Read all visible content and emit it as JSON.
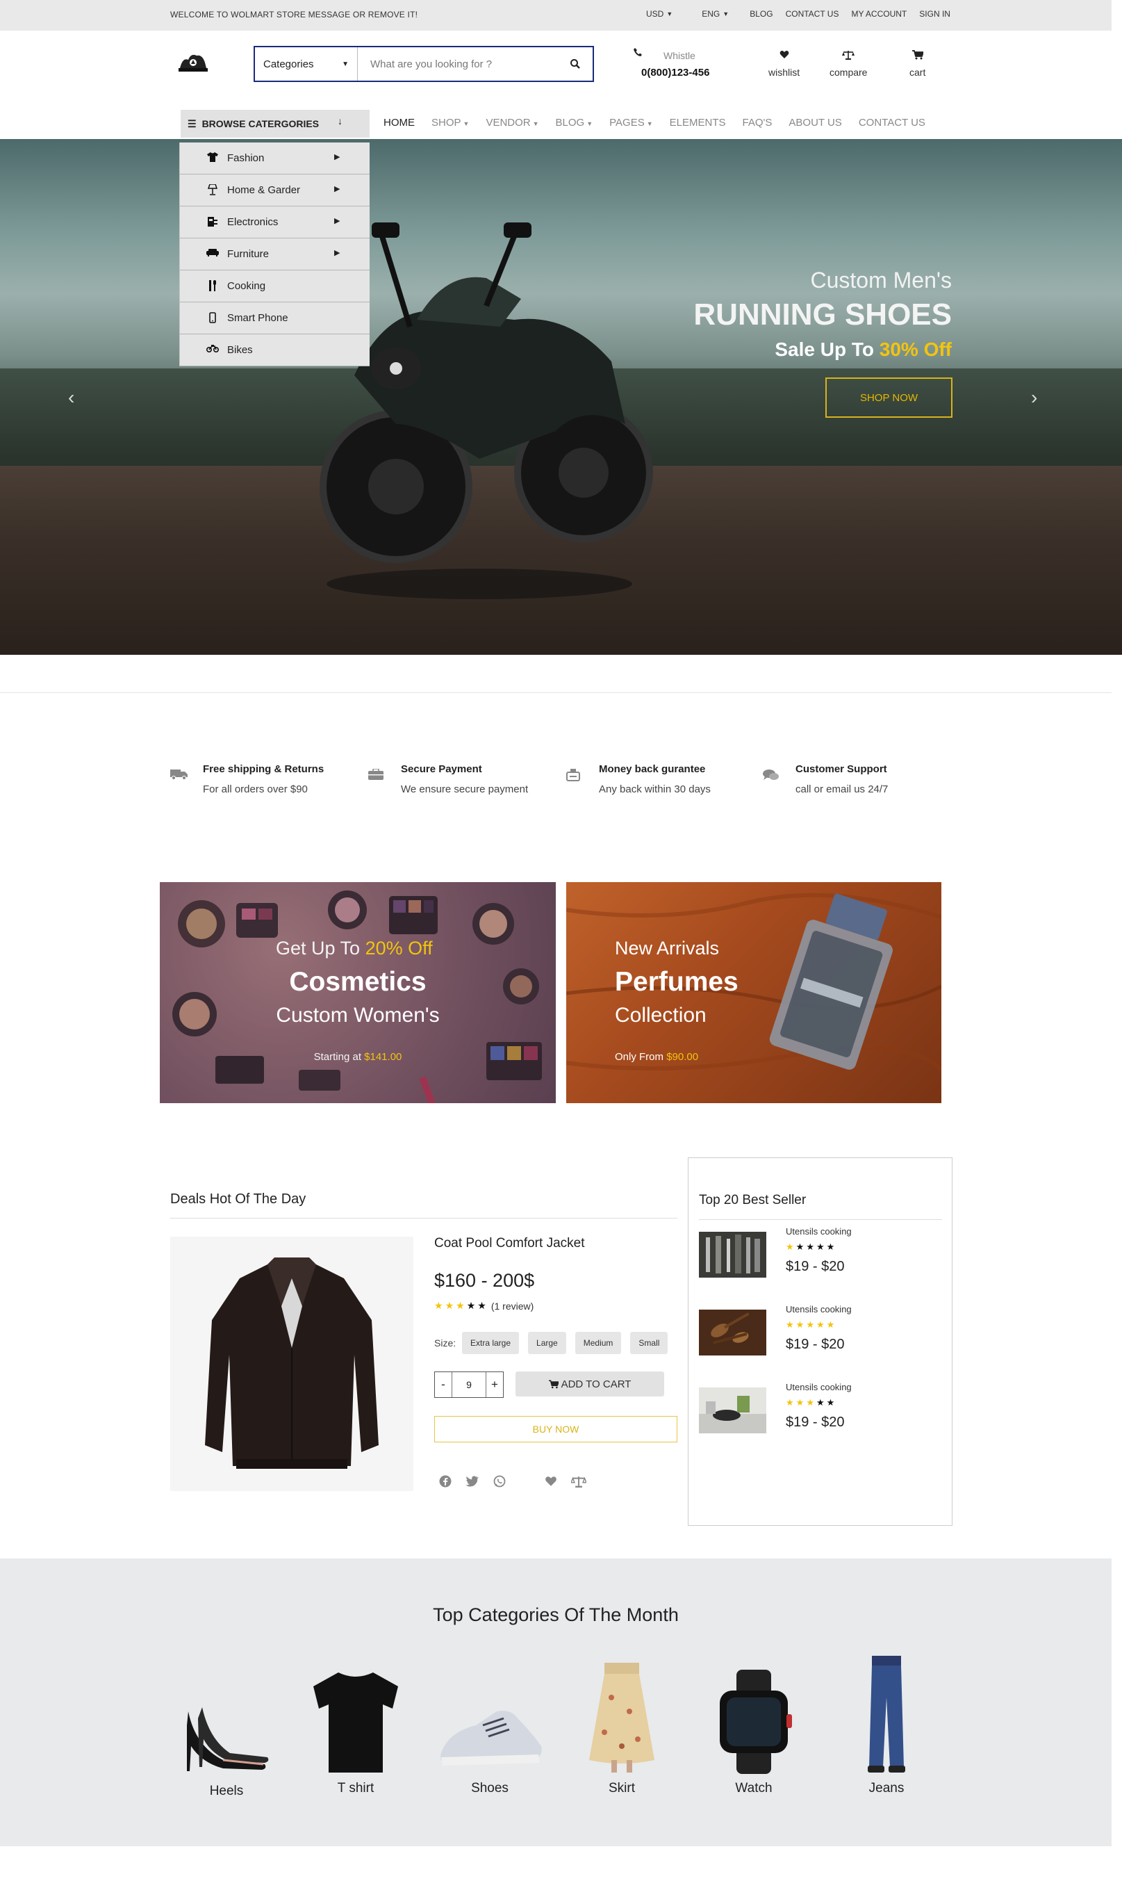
{
  "topbar": {
    "welcome": "WELCOME TO WOLMART STORE MESSAGE OR REMOVE IT!",
    "currency": "USD",
    "language": "ENG",
    "links": [
      "BLOG",
      "CONTACT US",
      "MY ACCOUNT",
      "SIGN IN"
    ]
  },
  "header": {
    "search": {
      "category": "Categories",
      "placeholder": "What are you looking for ?"
    },
    "contact": {
      "label": "Whistle",
      "phone": "0(800)123-456"
    },
    "icons": {
      "wishlist": "wishlist",
      "compare": "compare",
      "cart": "cart"
    }
  },
  "nav": {
    "browse": "BROWSE CATERGORIES",
    "items": [
      "HOME",
      "SHOP",
      "VENDOR",
      "BLOG",
      "PAGES",
      "ELEMENTS",
      "FAQ'S",
      "ABOUT US",
      "CONTACT US"
    ]
  },
  "categories": [
    {
      "label": "Fashion",
      "icon": "tshirt-icon"
    },
    {
      "label": "Home & Garder",
      "icon": "lamp-icon"
    },
    {
      "label": "Electronics",
      "icon": "plug-icon"
    },
    {
      "label": "Furniture",
      "icon": "sofa-icon"
    },
    {
      "label": "Cooking",
      "icon": "utensils-icon"
    },
    {
      "label": "Smart Phone",
      "icon": "phone-icon"
    },
    {
      "label": "Bikes",
      "icon": "motorcycle-icon"
    }
  ],
  "hero": {
    "line1": "Custom Men's",
    "line2": "RUNNING SHOES",
    "line3_prefix": "Sale Up To ",
    "line3_highlight": "30% Off",
    "button": "SHOP NOW"
  },
  "features": [
    {
      "title": "Free shipping & Returns",
      "subtitle": "For all orders over $90",
      "icon": "truck-icon"
    },
    {
      "title": "Secure Payment",
      "subtitle": "We ensure secure payment",
      "icon": "briefcase-icon"
    },
    {
      "title": "Money back gurantee",
      "subtitle": "Any back within 30 days",
      "icon": "money-box-icon"
    },
    {
      "title": "Customer Support",
      "subtitle": "call or email us 24/7",
      "icon": "chat-icon"
    }
  ],
  "banners": {
    "cosmetics": {
      "l1_prefix": "Get Up To ",
      "l1_highlight": "20% Off",
      "l2": "Cosmetics",
      "l3": "Custom Women's",
      "l4_prefix": "Starting at ",
      "l4_highlight": "$141.00"
    },
    "perfumes": {
      "l1": "New Arrivals",
      "l2": "Perfumes",
      "l3": "Collection",
      "l4_prefix": "Only From ",
      "l4_highlight": "$90.00"
    }
  },
  "deals": {
    "title": "Deals Hot Of The Day",
    "product": {
      "name": "Coat Pool Comfort Jacket",
      "price": "$160 - 200$",
      "rating": 3,
      "review": "(1 review)",
      "size_label": "Size:",
      "sizes": [
        "Extra large",
        "Large",
        "Medium",
        "Small"
      ],
      "qty": "9",
      "add_to_cart": "ADD TO CART",
      "buy_now": "BUY NOW"
    }
  },
  "bestseller": {
    "title": "Top 20 Best Seller",
    "items": [
      {
        "name": "Utensils cooking",
        "price": "$19 - $20",
        "rating": 1
      },
      {
        "name": "Utensils cooking",
        "price": "$19 - $20",
        "rating": 5
      },
      {
        "name": "Utensils cooking",
        "price": "$19 - $20",
        "rating": 3
      }
    ]
  },
  "topcategories": {
    "title": "Top Categories Of The Month",
    "items": [
      "Heels",
      "T shirt",
      "Shoes",
      "Skirt",
      "Watch",
      "Jeans"
    ]
  },
  "colors": {
    "accent": "#f1c40f",
    "navy": "#1a2b7a"
  }
}
